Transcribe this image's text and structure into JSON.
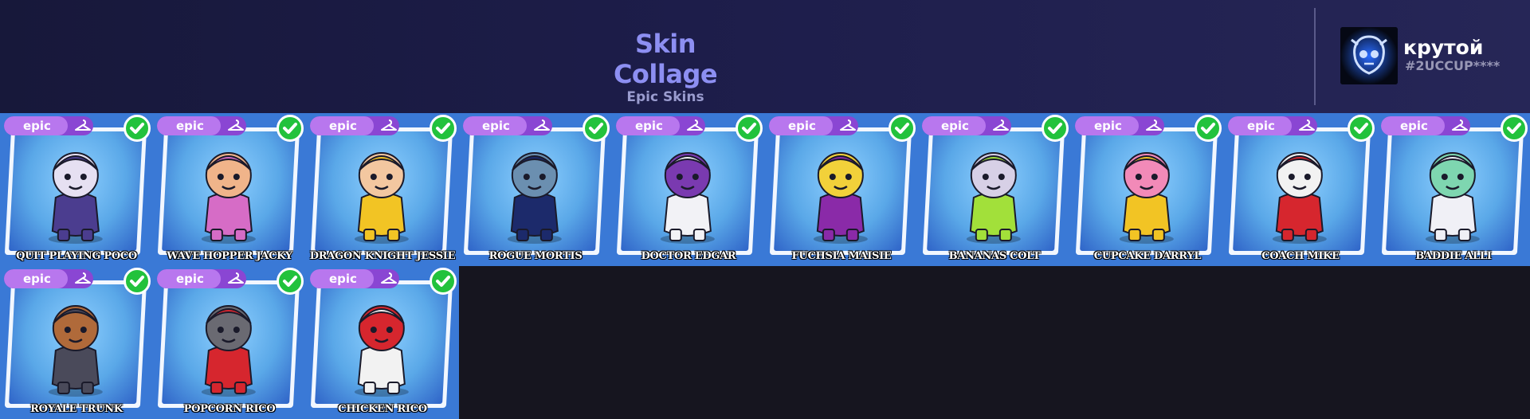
{
  "header": {
    "title": "Skin Collage",
    "subtitle": "Epic Skins"
  },
  "player": {
    "name": "крутой",
    "tag": "#2UCCUP****",
    "avatar_icon": "skull-mask-icon"
  },
  "colors": {
    "tile_blue": "#3a79d6",
    "rarity_epic": "#b877ee",
    "owned_check": "#22c23c",
    "title": "#8d8ff2"
  },
  "skins": [
    {
      "name": "QUIT PLAYING POCO",
      "rarity": "epic",
      "owned": true,
      "bg": "#5aa8e8",
      "accent": "#4b3d8f",
      "face": "#e6e0f2"
    },
    {
      "name": "WAVE HOPPER JACKY",
      "rarity": "epic",
      "owned": true,
      "bg": "#5aa8e8",
      "accent": "#d66cc6",
      "face": "#f0b48a"
    },
    {
      "name": "DRAGON KNIGHT JESSIE",
      "rarity": "epic",
      "owned": true,
      "bg": "#5aa8e8",
      "accent": "#f2c424",
      "face": "#f3c7a0"
    },
    {
      "name": "ROGUE MORTIS",
      "rarity": "epic",
      "owned": true,
      "bg": "#5aa8e8",
      "accent": "#1c2a6b",
      "face": "#6b8fb0"
    },
    {
      "name": "DOCTOR EDGAR",
      "rarity": "epic",
      "owned": true,
      "bg": "#5aa8e8",
      "accent": "#f2f2f6",
      "face": "#7a3ab0"
    },
    {
      "name": "FUCHSIA MAISIE",
      "rarity": "epic",
      "owned": true,
      "bg": "#5aa8e8",
      "accent": "#8a2aa8",
      "face": "#f2d13a"
    },
    {
      "name": "BANANAS COLT",
      "rarity": "epic",
      "owned": true,
      "bg": "#5aa8e8",
      "accent": "#a2e03a",
      "face": "#d7d0e6"
    },
    {
      "name": "CUPCAKE DARRYL",
      "rarity": "epic",
      "owned": true,
      "bg": "#5aa8e8",
      "accent": "#f2c424",
      "face": "#f28ab8"
    },
    {
      "name": "COACH MIKE",
      "rarity": "epic",
      "owned": true,
      "bg": "#5aa8e8",
      "accent": "#d6262e",
      "face": "#f2f2f2"
    },
    {
      "name": "BADDIE ALLI",
      "rarity": "epic",
      "owned": true,
      "bg": "#5aa8e8",
      "accent": "#f0f0f6",
      "face": "#7ed6b0"
    },
    {
      "name": "ROYALE TRUNK",
      "rarity": "epic",
      "owned": true,
      "bg": "#5aa8e8",
      "accent": "#4a4a5a",
      "face": "#b06a3a"
    },
    {
      "name": "POPCORN RICO",
      "rarity": "epic",
      "owned": true,
      "bg": "#5aa8e8",
      "accent": "#d6262e",
      "face": "#6a6a72"
    },
    {
      "name": "CHICKEN RICO",
      "rarity": "epic",
      "owned": true,
      "bg": "#5aa8e8",
      "accent": "#f2f2f2",
      "face": "#d6262e"
    }
  ]
}
